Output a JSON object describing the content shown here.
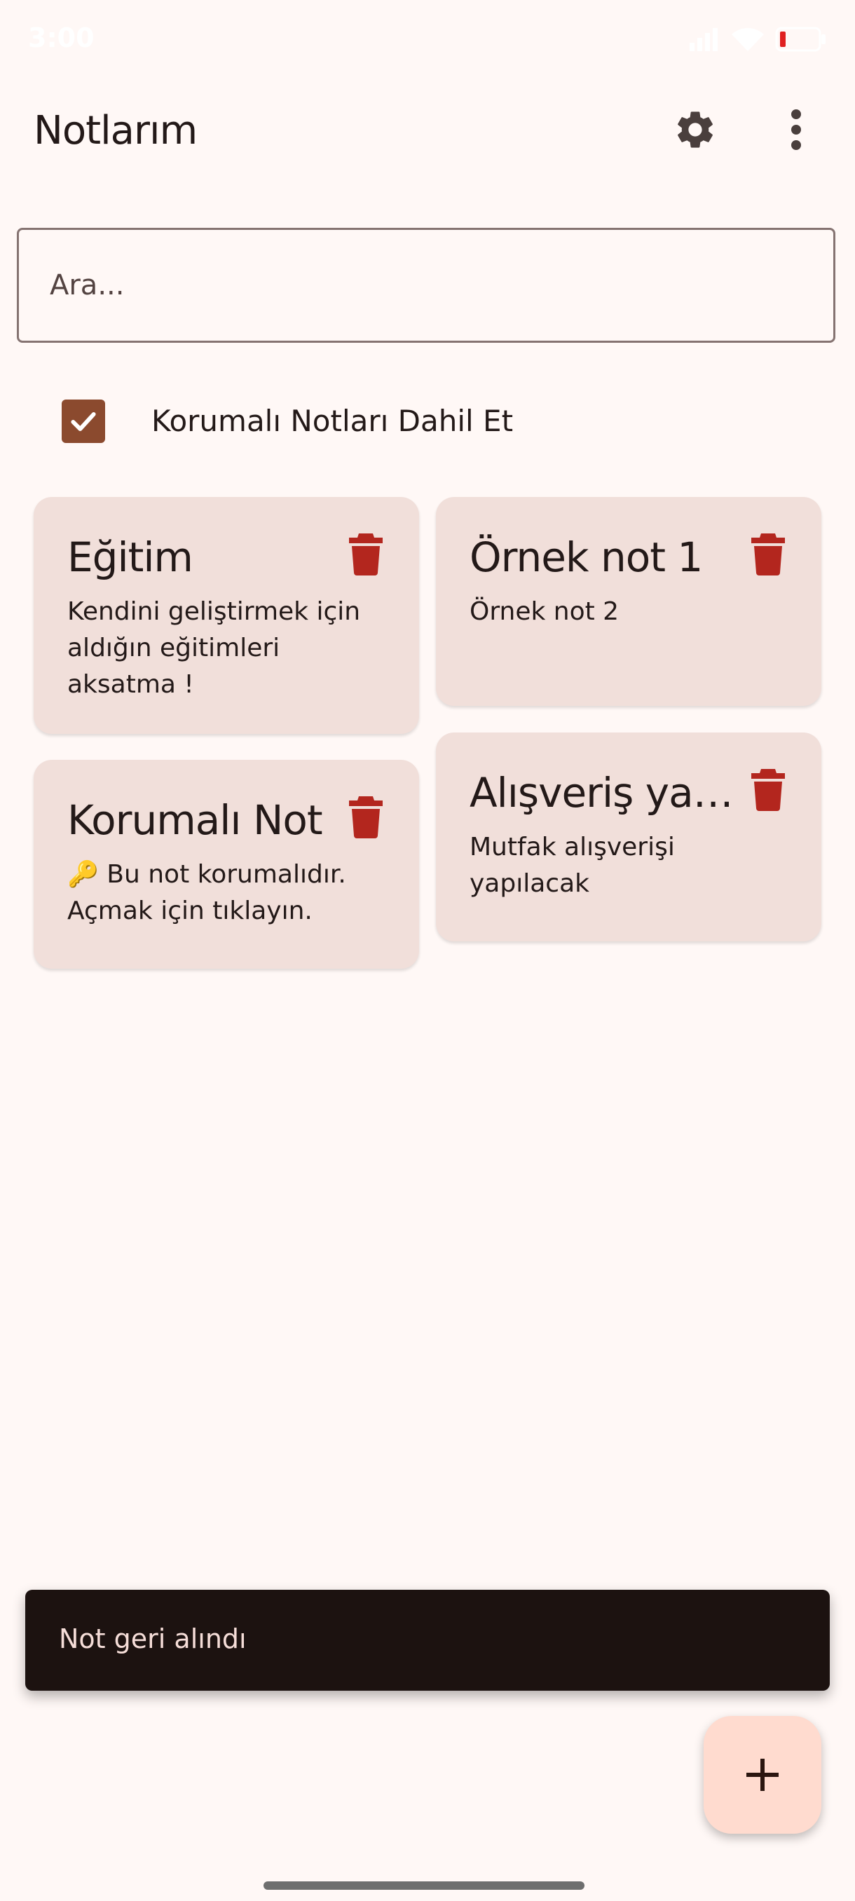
{
  "status_bar": {
    "time": "3:00",
    "icons": [
      "signal-icon",
      "wifi-icon",
      "battery-icon"
    ]
  },
  "app_bar": {
    "title": "Notlarım",
    "actions": [
      "settings-icon",
      "more-vert-icon"
    ]
  },
  "search": {
    "placeholder": "Ara..."
  },
  "filter": {
    "label": "Korumalı Notları Dahil Et",
    "checked": true
  },
  "notes": [
    {
      "title": "Eğitim",
      "body": "Kendini geliştirmek için aldığın eğitimleri aksatma !",
      "protected": false
    },
    {
      "title": "Örnek not 1",
      "body": "Örnek not 2",
      "protected": false
    },
    {
      "title": "Korumalı Not",
      "body": "🔑 Bu not korumalıdır. Açmak için tıklayın.",
      "protected": true
    },
    {
      "title": "Alışveriş yapılacak",
      "body": "Mutfak alışverişi yapılacak",
      "protected": false
    }
  ],
  "snackbar": {
    "message": "Not geri alındı"
  },
  "fab": {
    "icon": "add-icon"
  },
  "colors": {
    "background": "#fff8f6",
    "card": "#f1dfda",
    "delete": "#b3261e",
    "checkbox": "#8b4a2e",
    "snackbar": "#1c1210",
    "fab": "#ffdbcf"
  }
}
